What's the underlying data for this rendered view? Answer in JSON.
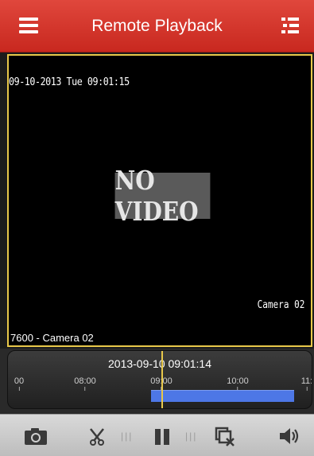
{
  "header": {
    "title": "Remote Playback",
    "menu_icon": "menu-icon",
    "list_icon": "list-icon"
  },
  "video": {
    "osd_timestamp": "09-10-2013 Tue 09:01:15",
    "no_video_text": "NO VIDEO",
    "osd_camera": "Camera 02",
    "label": "7600 - Camera 02"
  },
  "timeline": {
    "current_time": "2013-09-10 09:01:14",
    "ticks": [
      "00",
      "08:00",
      "09:00",
      "10:00",
      "11:"
    ],
    "recording_segment": {
      "start": "09:00",
      "end": "10:40"
    },
    "cursor_time": "09:01:14"
  },
  "toolbar": {
    "icons": [
      "camera-icon",
      "scissors-icon",
      "pause-icon",
      "close-all-icon",
      "volume-icon"
    ]
  },
  "colors": {
    "header_red": "#d33a2f",
    "cursor_yellow": "#e8c84a",
    "segment_blue": "#4d77e6"
  }
}
